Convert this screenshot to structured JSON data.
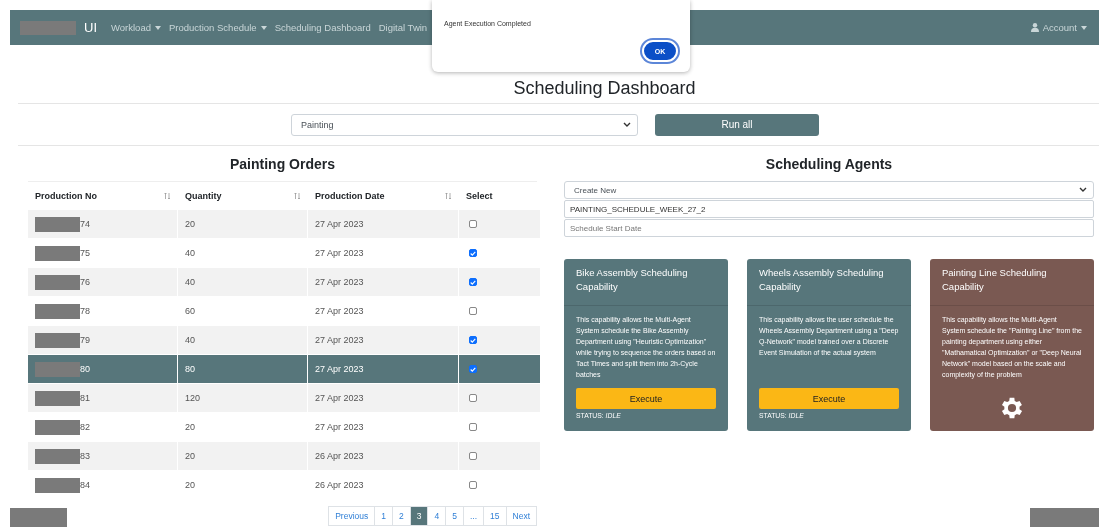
{
  "navbar": {
    "brand": "UI",
    "items": [
      {
        "label": "Workload",
        "dropdown": true
      },
      {
        "label": "Production Schedule",
        "dropdown": true
      },
      {
        "label": "Scheduling Dashboard",
        "dropdown": false
      },
      {
        "label": "Digital Twin",
        "dropdown": false
      }
    ],
    "account": {
      "label": "Account",
      "dropdown": true
    }
  },
  "dialog": {
    "message": "Agent Execution Completed",
    "button": "OK"
  },
  "page_title": "Scheduling Dashboard",
  "department_select": {
    "value": "Painting"
  },
  "run_all_button": "Run all",
  "orders": {
    "title": "Painting Orders",
    "columns": [
      {
        "label": "Production No",
        "sortable": true
      },
      {
        "label": "Quantity",
        "sortable": true
      },
      {
        "label": "Production Date",
        "sortable": true
      },
      {
        "label": "Select",
        "sortable": false
      }
    ],
    "rows": [
      {
        "production_no": "74",
        "quantity": "20",
        "date": "27 Apr 2023",
        "checked": false,
        "selected": false
      },
      {
        "production_no": "75",
        "quantity": "40",
        "date": "27 Apr 2023",
        "checked": true,
        "selected": false
      },
      {
        "production_no": "76",
        "quantity": "40",
        "date": "27 Apr 2023",
        "checked": true,
        "selected": false
      },
      {
        "production_no": "78",
        "quantity": "60",
        "date": "27 Apr 2023",
        "checked": false,
        "selected": false
      },
      {
        "production_no": "79",
        "quantity": "40",
        "date": "27 Apr 2023",
        "checked": true,
        "selected": false
      },
      {
        "production_no": "80",
        "quantity": "80",
        "date": "27 Apr 2023",
        "checked": true,
        "selected": true
      },
      {
        "production_no": "81",
        "quantity": "120",
        "date": "27 Apr 2023",
        "checked": false,
        "selected": false
      },
      {
        "production_no": "82",
        "quantity": "20",
        "date": "27 Apr 2023",
        "checked": false,
        "selected": false
      },
      {
        "production_no": "83",
        "quantity": "20",
        "date": "26 Apr 2023",
        "checked": false,
        "selected": false
      },
      {
        "production_no": "84",
        "quantity": "20",
        "date": "26 Apr 2023",
        "checked": false,
        "selected": false
      }
    ],
    "pagination": [
      {
        "label": "Previous",
        "selected": false
      },
      {
        "label": "1",
        "selected": false
      },
      {
        "label": "2",
        "selected": false
      },
      {
        "label": "3",
        "selected": true
      },
      {
        "label": "4",
        "selected": false
      },
      {
        "label": "5",
        "selected": false
      },
      {
        "label": "...",
        "selected": false
      },
      {
        "label": "15",
        "selected": false
      },
      {
        "label": "Next",
        "selected": false
      }
    ]
  },
  "agents": {
    "title": "Scheduling Agents",
    "schedule_select": {
      "value": "Create New"
    },
    "schedule_name": {
      "value": "PAINTING_SCHEDULE_WEEK_27_2"
    },
    "start_date": {
      "placeholder": "Schedule Start Date"
    },
    "cards": [
      {
        "kind": "execute",
        "color": "#57767b",
        "title": "Bike Assembly Scheduling Capability",
        "description": "This capability allows the Multi-Agent System schedule the Bike Assembly Department using \"Heuristic Optimization\" while trying to sequence the orders based on Tact Times and split them into 2h-Cycle batches",
        "button": "Execute",
        "status": "STATUS: *IDLE*"
      },
      {
        "kind": "execute",
        "color": "#57767b",
        "title": "Wheels Assembly Scheduling Capability",
        "description": "This capability allows the user schedule the Wheels Assembly Department using a \"Deep Q-Network\" model trained over a Discrete Event Simulation of the actual system",
        "button": "Execute",
        "status": "STATUS: *IDLE*"
      },
      {
        "kind": "busy",
        "color": "#7a5952",
        "title": "Painting Line Scheduling Capability",
        "description": "This capability allows the Multi-Agent System schedule the \"Painting Line\" from the painting department using either \"Mathamatical Optimization\" or \"Deep Neural Network\" model based on the scale and complexity of the problem"
      }
    ]
  }
}
